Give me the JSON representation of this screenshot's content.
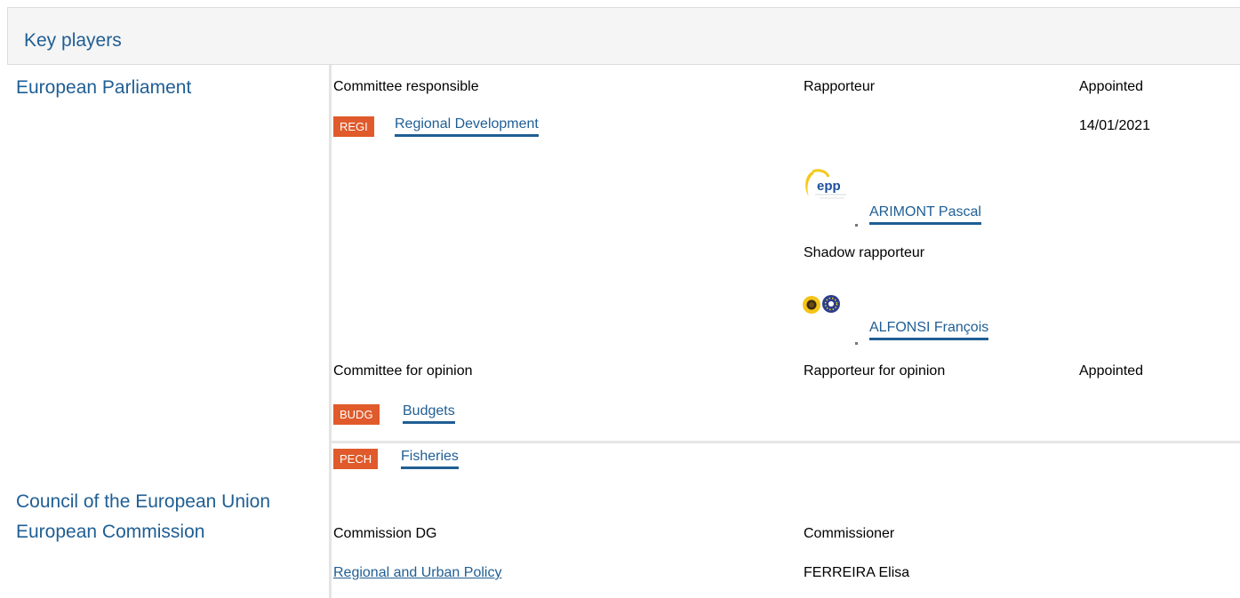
{
  "header": {
    "title": "Key players"
  },
  "institutions": {
    "ep": "European Parliament",
    "council": "Council of the European Union",
    "commission": "European Commission"
  },
  "ep_section": {
    "committee_responsible_label": "Committee responsible",
    "rapporteur_label": "Rapporteur",
    "appointed_label": "Appointed",
    "responsible_committee": {
      "code": "REGI",
      "name": "Regional Development",
      "appointed": "14/01/2021"
    },
    "rapporteur": {
      "name": "ARIMONT Pascal",
      "logo": "epp"
    },
    "shadow_rapporteur_label": "Shadow rapporteur",
    "shadow_rapporteur": {
      "name": "ALFONSI François",
      "logo": "greens-efa"
    },
    "committee_opinion_label": "Committee for opinion",
    "rapporteur_opinion_label": "Rapporteur for opinion",
    "appointed_opinion_label": "Appointed",
    "opinion_committees": [
      {
        "code": "BUDG",
        "name": "Budgets"
      },
      {
        "code": "PECH",
        "name": "Fisheries"
      }
    ]
  },
  "commission_section": {
    "dg_label": "Commission DG",
    "commissioner_label": "Commissioner",
    "dg": "Regional and Urban Policy",
    "commissioner": "FERREIRA Elisa"
  },
  "colors": {
    "link": "#1f5e94",
    "badge": "#e05a2b",
    "panel_bg": "#f5f5f5"
  }
}
